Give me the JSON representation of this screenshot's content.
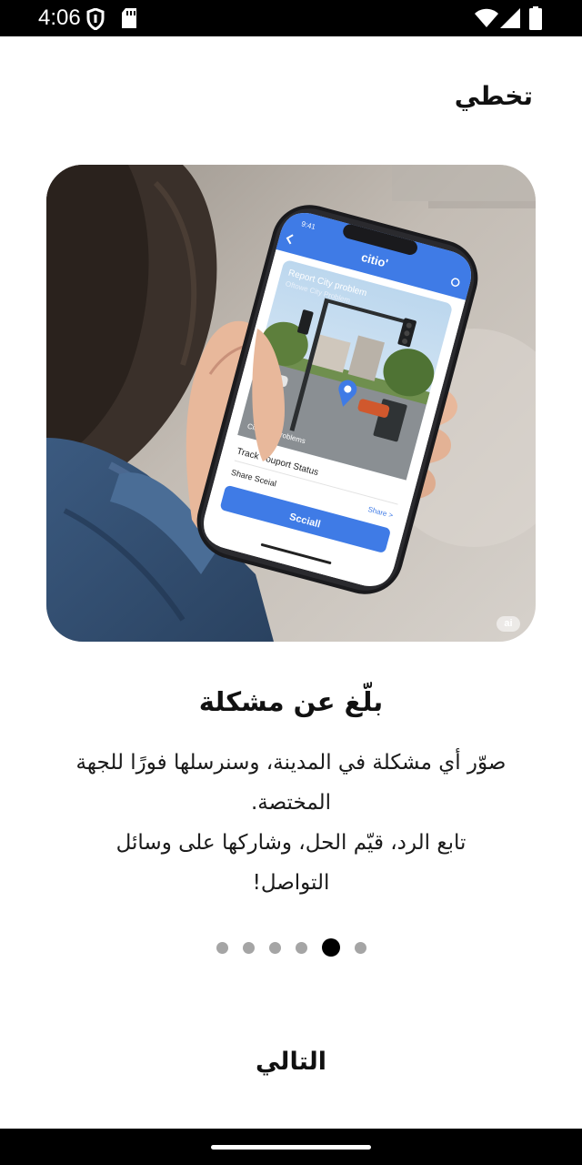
{
  "status_bar": {
    "time": "4:06",
    "icons": [
      "vpn-shield-icon",
      "sd-card-icon",
      "wifi-icon",
      "cell-signal-icon",
      "battery-icon"
    ]
  },
  "header": {
    "skip_label": "تخطي"
  },
  "illustration": {
    "badge": "ai",
    "phone_screen": {
      "time": "9:41",
      "app_name": "citio'",
      "card_title": "Report City problem",
      "card_subtitle": "Oftowe City Problem",
      "photo_caption_left": "City",
      "photo_caption_right": "Problems",
      "track_label": "Track Youport Status",
      "share_label": "Share Sceial",
      "share_link": "Share >",
      "button_label": "Scciall"
    }
  },
  "slide": {
    "title": "بلّغ عن مشكلة",
    "description_lines": [
      "صوّر أي مشكلة في المدينة، وسنرسلها فورًا للجهة",
      "المختصة.",
      "تابع الرد، قيّم الحل، وشاركها على وسائل",
      "التواصل!"
    ]
  },
  "pager": {
    "count": 6,
    "active_index": 4
  },
  "footer": {
    "next_label": "التالي"
  },
  "colors": {
    "accent": "#3f7be6",
    "dot_inactive": "#a5a5a5",
    "dot_active": "#000000",
    "bar": "#000000"
  }
}
